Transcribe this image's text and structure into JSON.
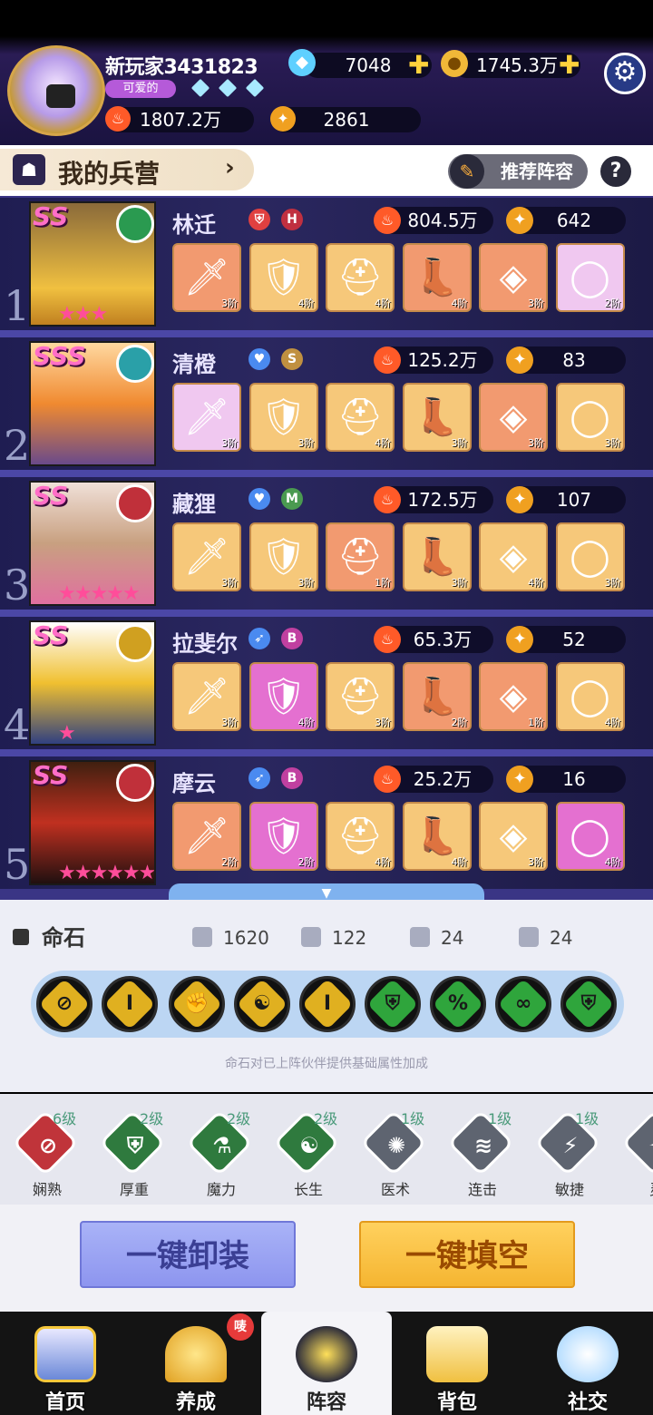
{
  "player": {
    "name": "新玩家3431823",
    "tag": "可爱的",
    "diamonds": "7048",
    "gold": "1745.3万",
    "power": "1807.2万",
    "stars": "2861"
  },
  "header": {
    "title": "我的兵营",
    "recommend_label": "推荐阵容",
    "help_label": "?"
  },
  "heroes": [
    {
      "index": "1",
      "name": "林迁",
      "rank": "SS",
      "badge2": "H",
      "power": "804.5万",
      "stars_val": "642",
      "stars": "★★★",
      "equips": [
        {
          "lv": "3阶"
        },
        {
          "lv": "4阶"
        },
        {
          "lv": "4阶"
        },
        {
          "lv": "4阶"
        },
        {
          "lv": "3阶"
        },
        {
          "lv": "2阶"
        }
      ]
    },
    {
      "index": "2",
      "name": "清橙",
      "rank": "SSS",
      "badge2": "S",
      "power": "125.2万",
      "stars_val": "83",
      "stars": "",
      "equips": [
        {
          "lv": "3阶"
        },
        {
          "lv": "3阶"
        },
        {
          "lv": "4阶"
        },
        {
          "lv": "3阶"
        },
        {
          "lv": "3阶"
        },
        {
          "lv": "3阶"
        }
      ]
    },
    {
      "index": "3",
      "name": "藏狸",
      "rank": "SS",
      "badge2": "M",
      "power": "172.5万",
      "stars_val": "107",
      "stars": "★★★★★",
      "equips": [
        {
          "lv": "3阶"
        },
        {
          "lv": "3阶"
        },
        {
          "lv": "1阶"
        },
        {
          "lv": "3阶"
        },
        {
          "lv": "4阶"
        },
        {
          "lv": "3阶"
        }
      ]
    },
    {
      "index": "4",
      "name": "拉斐尔",
      "rank": "SS",
      "badge2": "B",
      "power": "65.3万",
      "stars_val": "52",
      "stars": "★",
      "equips": [
        {
          "lv": "3阶"
        },
        {
          "lv": "4阶"
        },
        {
          "lv": "3阶"
        },
        {
          "lv": "2阶"
        },
        {
          "lv": "1阶"
        },
        {
          "lv": "4阶"
        }
      ]
    },
    {
      "index": "5",
      "name": "摩云",
      "rank": "SS",
      "badge2": "B",
      "power": "25.2万",
      "stars_val": "16",
      "stars": "★★★★★★",
      "equips": [
        {
          "lv": "2阶"
        },
        {
          "lv": "2阶"
        },
        {
          "lv": "4阶"
        },
        {
          "lv": "4阶"
        },
        {
          "lv": "3阶"
        },
        {
          "lv": "4阶"
        }
      ]
    }
  ],
  "fate_stone": {
    "title": "命石",
    "stat_hp": "1620",
    "stat_atk": "122",
    "stat_def1": "24",
    "stat_def2": "24",
    "hint": "命石对已上阵伙伴提供基础属性加成"
  },
  "skills": [
    {
      "name": "娴熟",
      "level": "6级",
      "color": "#c0343a"
    },
    {
      "name": "厚重",
      "level": "2级",
      "color": "#2f7a3e"
    },
    {
      "name": "魔力",
      "level": "2级",
      "color": "#2f7a3e"
    },
    {
      "name": "长生",
      "level": "2级",
      "color": "#2f7a3e"
    },
    {
      "name": "医术",
      "level": "1级",
      "color": "#5e6470"
    },
    {
      "name": "连击",
      "level": "1级",
      "color": "#5e6470"
    },
    {
      "name": "敏捷",
      "level": "1级",
      "color": "#5e6470"
    },
    {
      "name": "灵",
      "level": "",
      "color": "#5e6470"
    }
  ],
  "actions": {
    "unequip_all": "一键卸装",
    "fill_all": "一键填空"
  },
  "nav": {
    "home": "首页",
    "train": "养成",
    "lineup": "阵容",
    "bag": "背包",
    "social": "社交",
    "train_badge": "唛"
  }
}
